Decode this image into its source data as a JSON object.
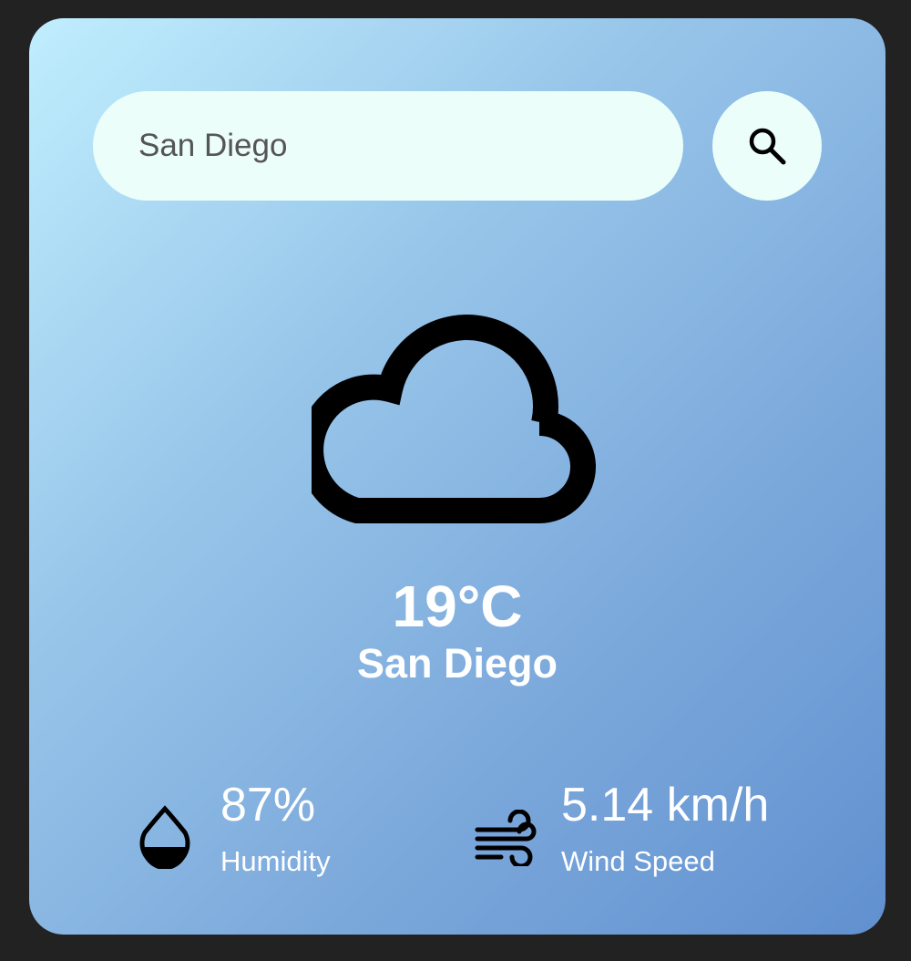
{
  "search": {
    "value": "San Diego",
    "button_icon": "search-icon"
  },
  "weather": {
    "icon": "cloud-icon",
    "temperature": "19°C",
    "city": "San Diego"
  },
  "details": {
    "humidity": {
      "icon": "humidity-drop-icon",
      "value": "87%",
      "label": "Humidity"
    },
    "wind": {
      "icon": "wind-icon",
      "value": "5.14 km/h",
      "label": "Wind Speed"
    }
  },
  "colors": {
    "page_background": "#222222",
    "card_gradient_start": "#c0eefe",
    "card_gradient_end": "#6190d0",
    "input_background": "#ebfefa",
    "text": "#ffffff"
  }
}
